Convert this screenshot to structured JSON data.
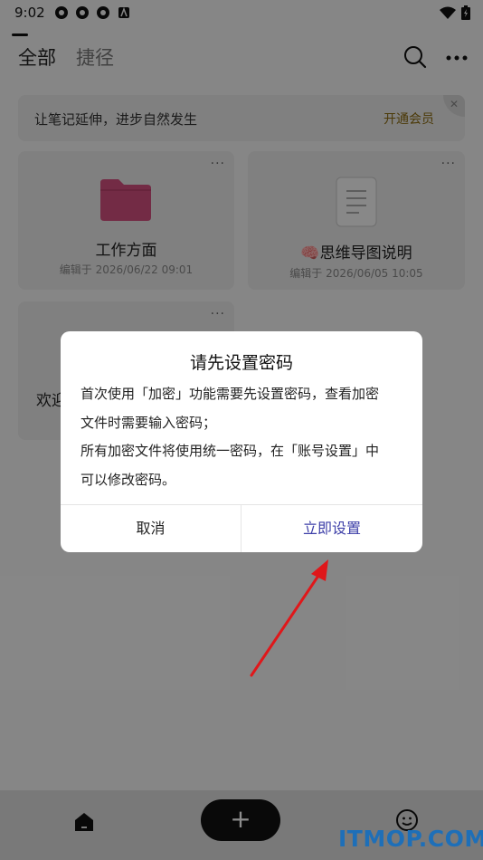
{
  "status": {
    "time": "9:02"
  },
  "tabs": [
    {
      "label": "全部"
    },
    {
      "label": "捷径"
    }
  ],
  "banner": {
    "text": "让笔记延伸，进步自然发生",
    "link": "开通会员"
  },
  "cards": [
    {
      "title": "工作方面",
      "meta": "编辑于 2026/06/22 09:01",
      "menu": "···"
    },
    {
      "title": "🧠思维导图说明",
      "meta": "编辑于 2026/06/05 10:05",
      "menu": "···"
    },
    {
      "title": "欢迎",
      "meta": "",
      "menu": "···"
    }
  ],
  "dialog": {
    "title": "请先设置密码",
    "body": [
      "首次使用「加密」功能需要先设置密码，查看加密",
      "文件时需要输入密码；",
      "所有加密文件将使用统一密码，在「账号设置」中",
      "可以修改密码。"
    ],
    "cancel": "取消",
    "confirm": "立即设置"
  },
  "bottom": {
    "add": "+"
  },
  "watermark": "ITMOP.COM",
  "colors": {
    "accent": "#3d3fa8",
    "folder": "#d14f7e",
    "arrow": "#e0171a"
  }
}
